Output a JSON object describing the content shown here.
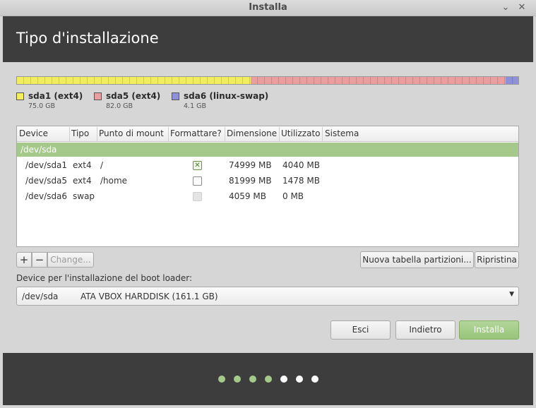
{
  "window": {
    "title": "Installa"
  },
  "header": {
    "title": "Tipo d'installazione"
  },
  "disk_bar": {
    "segments": [
      {
        "fraction": 0.466,
        "color": "#f2ec5f"
      },
      {
        "fraction": 0.509,
        "color": "#eb9ea0"
      },
      {
        "fraction": 0.025,
        "color": "#8f91d8"
      }
    ]
  },
  "legend": [
    {
      "label": "sda1 (ext4)",
      "size": "75.0 GB",
      "color": "#f2ec5f"
    },
    {
      "label": "sda5 (ext4)",
      "size": "82.0 GB",
      "color": "#eb9ea0"
    },
    {
      "label": "sda6 (linux-swap)",
      "size": "4.1 GB",
      "color": "#8f91d8"
    }
  ],
  "table": {
    "columns": [
      "Device",
      "Tipo",
      "Punto di mount",
      "Formattare?",
      "Dimensione",
      "Utilizzato",
      "Sistema"
    ],
    "group": "/dev/sda",
    "rows": [
      {
        "device": "/dev/sda1",
        "type": "ext4",
        "mount": "/",
        "format": "checked",
        "size": "74999 MB",
        "used": "4040 MB",
        "system": ""
      },
      {
        "device": "/dev/sda5",
        "type": "ext4",
        "mount": "/home",
        "format": "unchecked",
        "size": "81999 MB",
        "used": "1478 MB",
        "system": ""
      },
      {
        "device": "/dev/sda6",
        "type": "swap",
        "mount": "",
        "format": "disabled",
        "size": "4059 MB",
        "used": "0 MB",
        "system": ""
      }
    ]
  },
  "toolbar": {
    "add": "+",
    "remove": "−",
    "change": "Change...",
    "new_table": "Nuova tabella partizioni...",
    "revert": "Ripristina"
  },
  "boot_loader": {
    "label": "Device per l'installazione del boot loader:",
    "device": "/dev/sda",
    "description": "ATA VBOX HARDDISK (161.1 GB)"
  },
  "actions": {
    "quit": "Esci",
    "back": "Indietro",
    "install": "Installa"
  },
  "progress": {
    "total_steps": 7,
    "completed_steps": 4
  },
  "colors": {
    "header_bg": "#3d3d3d",
    "accent_green": "#a5c98a"
  }
}
